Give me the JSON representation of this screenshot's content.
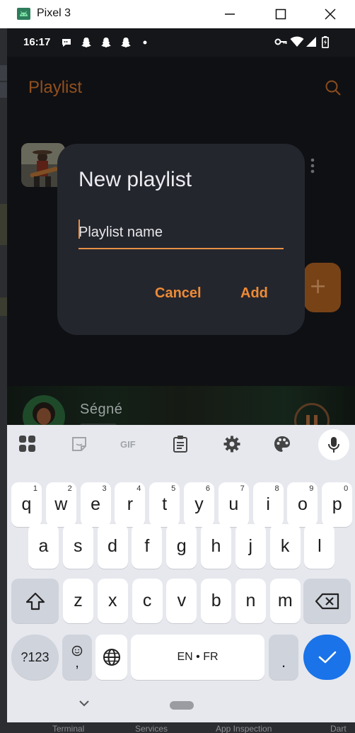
{
  "window": {
    "title": "Pixel 3"
  },
  "statusbar": {
    "time": "16:17"
  },
  "appbar": {
    "title": "Playlist"
  },
  "dialog": {
    "title": "New playlist",
    "input_placeholder": "Playlist name",
    "input_value": "",
    "cancel_label": "Cancel",
    "add_label": "Add"
  },
  "miniplayer": {
    "title": "Ségné"
  },
  "keyboard": {
    "row1": [
      {
        "k": "q",
        "h": "1"
      },
      {
        "k": "w",
        "h": "2"
      },
      {
        "k": "e",
        "h": "3"
      },
      {
        "k": "r",
        "h": "4"
      },
      {
        "k": "t",
        "h": "5"
      },
      {
        "k": "y",
        "h": "6"
      },
      {
        "k": "u",
        "h": "7"
      },
      {
        "k": "i",
        "h": "8"
      },
      {
        "k": "o",
        "h": "9"
      },
      {
        "k": "p",
        "h": "0"
      }
    ],
    "row2": [
      "a",
      "s",
      "d",
      "f",
      "g",
      "h",
      "j",
      "k",
      "l"
    ],
    "row3": [
      "z",
      "x",
      "c",
      "v",
      "b",
      "n",
      "m"
    ],
    "symbols_label": "?123",
    "comma_label": ",",
    "space_label": "EN • FR",
    "period_label": "."
  },
  "ide": {
    "bottom_tabs": [
      "Terminal",
      "Services",
      "App Inspection",
      "Dart"
    ]
  },
  "colors": {
    "accent": "#ee8b35",
    "enter": "#1a73e8",
    "dialog_bg": "#24262e"
  }
}
